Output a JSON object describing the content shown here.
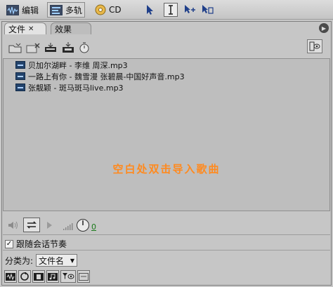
{
  "toolbar": {
    "edit_label": "编辑",
    "multitrack_label": "多轨",
    "cd_label": "CD"
  },
  "tabs": [
    {
      "label": "文件"
    },
    {
      "label": "效果"
    }
  ],
  "files": [
    {
      "name": "贝加尔湖畔 - 李维 周深.mp3"
    },
    {
      "name": "一路上有你 - 魏雪漫 张碧晨-中国好声音.mp3"
    },
    {
      "name": "张靓颖 - 斑马斑马live.mp3"
    }
  ],
  "hint": "空白处双击导入歌曲",
  "volume_value": "0",
  "follow_session": {
    "label": "跟随会话节奏",
    "checked": true
  },
  "sort": {
    "label": "分类为:",
    "value": "文件名"
  },
  "colors": {
    "accent_orange": "#ff8a1f",
    "file_icon": "#23436b"
  }
}
